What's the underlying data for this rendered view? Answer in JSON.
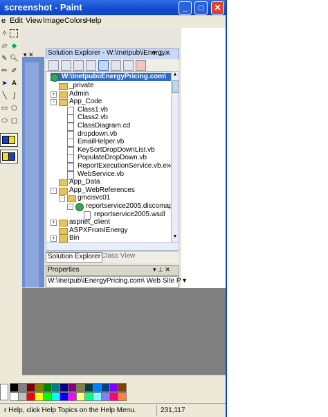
{
  "window": {
    "title": "screenshot - Paint",
    "min_label": "_",
    "max_label": "□",
    "close_label": "✕"
  },
  "menu": [
    "File",
    "Edit",
    "View",
    "Image",
    "Colors",
    "Help"
  ],
  "menu_display": [
    "e",
    "Edit",
    "View",
    "Image",
    "Colors",
    "Help"
  ],
  "solution_explorer": {
    "title": "Solution Explorer - W:\\Inetpub\\iEnergy...",
    "pin_label": "▾ ⊥ ✕",
    "root": "W:\\Inetpub\\iEnergyPricing.com\\",
    "items": [
      {
        "label": "_private",
        "type": "folder",
        "level": 1,
        "expand": ""
      },
      {
        "label": "Admin",
        "type": "folder",
        "level": 1,
        "expand": "+"
      },
      {
        "label": "App_Code",
        "type": "folder",
        "level": 1,
        "expand": "-"
      },
      {
        "label": "Class1.vb",
        "type": "file",
        "level": 2,
        "expand": ""
      },
      {
        "label": "Class2.vb",
        "type": "file",
        "level": 2,
        "expand": ""
      },
      {
        "label": "ClassDiagram.cd",
        "type": "file",
        "level": 2,
        "expand": ""
      },
      {
        "label": "dropdown.vb",
        "type": "file",
        "level": 2,
        "expand": ""
      },
      {
        "label": "EmailHelper.vb",
        "type": "file",
        "level": 2,
        "expand": ""
      },
      {
        "label": "KeySortDropDownList.vb",
        "type": "file",
        "level": 2,
        "expand": ""
      },
      {
        "label": "PopulateDropDown.vb",
        "type": "file",
        "level": 2,
        "expand": ""
      },
      {
        "label": "ReportExecutionService.vb.exclude",
        "type": "file",
        "level": 2,
        "expand": ""
      },
      {
        "label": "WebService.vb",
        "type": "file",
        "level": 2,
        "expand": ""
      },
      {
        "label": "App_Data",
        "type": "folder",
        "level": 1,
        "expand": ""
      },
      {
        "label": "App_WebReferences",
        "type": "folder",
        "level": 1,
        "expand": "-"
      },
      {
        "label": "gmcisvc01",
        "type": "folder",
        "level": 2,
        "expand": "-"
      },
      {
        "label": "reportservice2005.discomap",
        "type": "globe",
        "level": 3,
        "expand": "-"
      },
      {
        "label": "reportservice2005.wsdl",
        "type": "file",
        "level": 4,
        "expand": ""
      },
      {
        "label": "aspnet_client",
        "type": "folder",
        "level": 1,
        "expand": "+"
      },
      {
        "label": "ASPXFromIEnergy",
        "type": "folder",
        "level": 1,
        "expand": ""
      },
      {
        "label": "Bin",
        "type": "folder",
        "level": 1,
        "expand": "+"
      }
    ],
    "tab_solution": "Solution Explorer",
    "tab_class": "Class View"
  },
  "properties": {
    "title": "Properties",
    "pin_label": "▾ ⊥ ✕",
    "selector": "W:\\Inetpub\\iEnergyPricing.com\\ Web Site P ▾"
  },
  "status": {
    "help_text": "r Help, click Help Topics on the Help Menu.",
    "coords": "231,117"
  },
  "palette": [
    "#000000",
    "#808080",
    "#800000",
    "#808000",
    "#008000",
    "#008080",
    "#000080",
    "#800080",
    "#808040",
    "#004040",
    "#0080ff",
    "#004080",
    "#8000ff",
    "#804000",
    "#ffffff",
    "#c0c0c0",
    "#ff0000",
    "#ffff00",
    "#00ff00",
    "#00ffff",
    "#0000ff",
    "#ff00ff",
    "#ffff80",
    "#00ff80",
    "#80ffff",
    "#8080ff",
    "#ff0080",
    "#ff8040"
  ]
}
